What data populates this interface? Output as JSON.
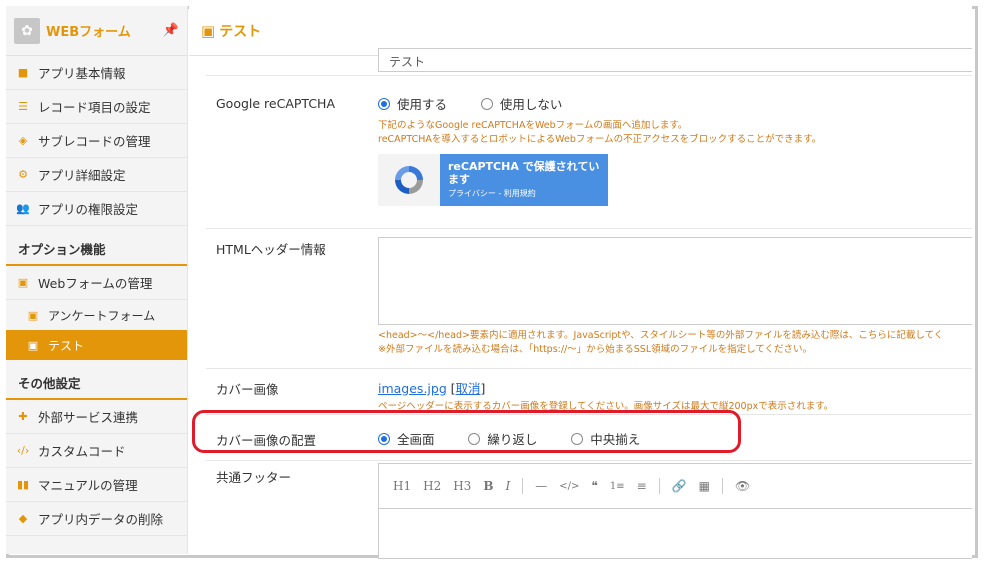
{
  "app": {
    "name": "WEBフォーム",
    "logo_icon": "app-logo-icon",
    "pin_icon": "pin-icon"
  },
  "page": {
    "title": "テスト"
  },
  "sidebar": {
    "items": [
      {
        "label": "アプリ基本情報",
        "icon": "info-icon"
      },
      {
        "label": "レコード項目の設定",
        "icon": "list-icon"
      },
      {
        "label": "サブレコードの管理",
        "icon": "layers-icon"
      },
      {
        "label": "アプリ詳細設定",
        "icon": "gear-icon"
      },
      {
        "label": "アプリの権限設定",
        "icon": "users-icon"
      }
    ],
    "option_title": "オプション機能",
    "option_items": [
      {
        "label": "Webフォームの管理",
        "icon": "form-icon"
      },
      {
        "label": "アンケートフォーム",
        "icon": "form-icon"
      },
      {
        "label": "テスト",
        "icon": "form-icon"
      }
    ],
    "other_title": "その他設定",
    "other_items": [
      {
        "label": "外部サービス連携",
        "icon": "puzzle-icon"
      },
      {
        "label": "カスタムコード",
        "icon": "code-icon"
      },
      {
        "label": "マニュアルの管理",
        "icon": "book-icon"
      },
      {
        "label": "アプリ内データの削除",
        "icon": "eraser-icon"
      }
    ]
  },
  "form": {
    "top_field_value": "テスト",
    "recaptcha": {
      "label": "Google reCAPTCHA",
      "option_use": "使用する",
      "option_no": "使用しない",
      "note1": "下記のようなGoogle reCAPTCHAをWebフォームの画面へ追加します。",
      "note2": "reCAPTCHAを導入するとロボットによるWebフォームの不正アクセスをブロックすることができます。",
      "badge_title": "reCAPTCHA で保護されています",
      "badge_sub": "プライバシー - 利用規約"
    },
    "html_header": {
      "label": "HTMLヘッダー情報",
      "note1": "<head>～</head>要素内に適用されます。JavaScriptや、スタイルシート等の外部ファイルを読み込む際は、こちらに記載してく",
      "note2": "※外部ファイルを読み込む場合は、「https://～」から始まるSSL領域のファイルを指定してください。"
    },
    "cover": {
      "label": "カバー画像",
      "file": "images.jpg",
      "cancel": "取消",
      "note": "ページヘッダーに表示するカバー画像を登録してください。画像サイズは最大で縦200pxで表示されます。"
    },
    "cover_position": {
      "label": "カバー画像の配置",
      "options": [
        "全画面",
        "繰り返し",
        "中央揃え"
      ]
    },
    "footer": {
      "label": "共通フッター",
      "toolbar": [
        "H1",
        "H2",
        "H3",
        "B",
        "I",
        "—",
        "</>",
        "❝",
        "1≡",
        "≡",
        "🔗",
        "▦",
        "👁"
      ]
    }
  }
}
